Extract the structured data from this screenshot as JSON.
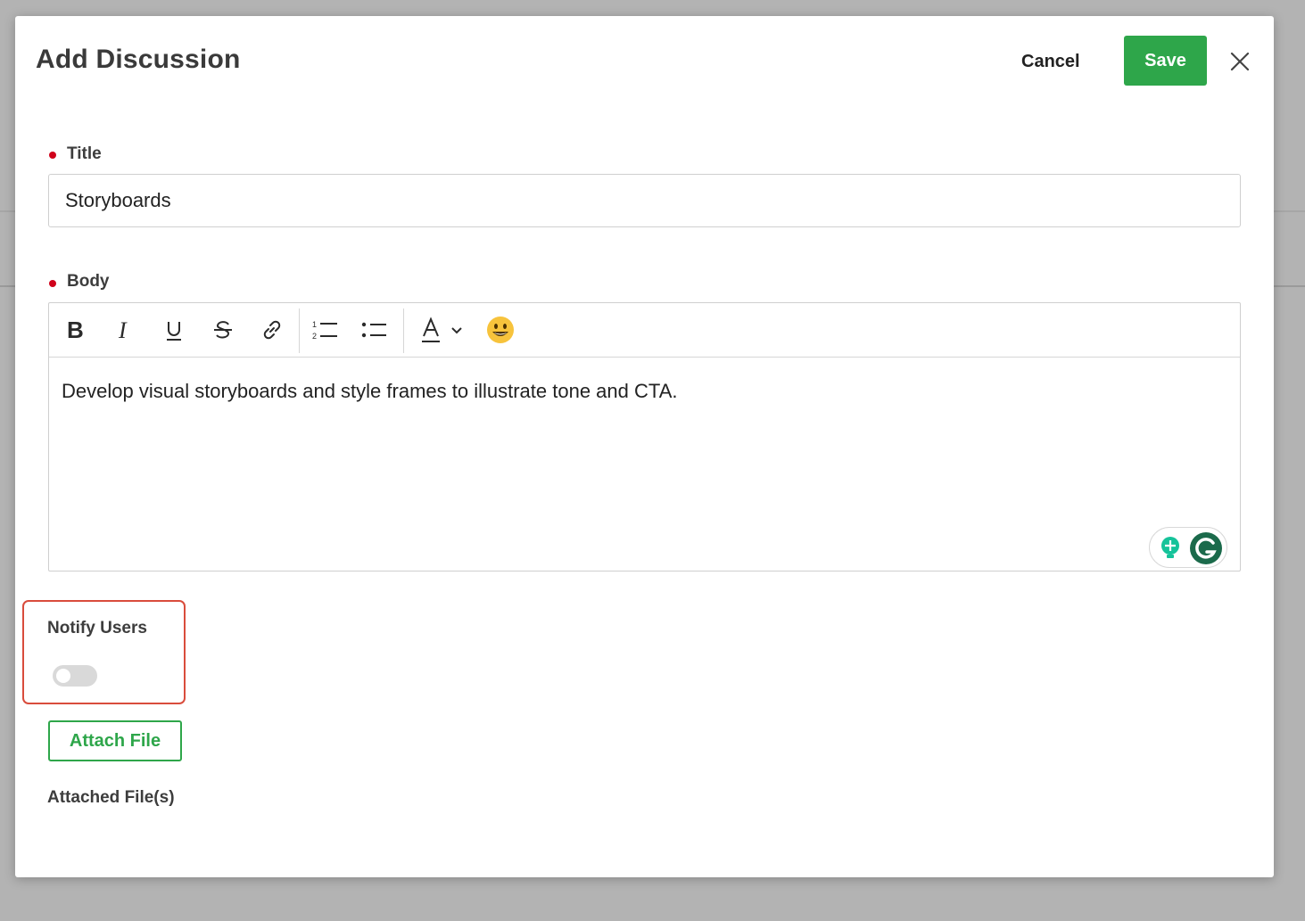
{
  "modal": {
    "title": "Add Discussion",
    "cancel_label": "Cancel",
    "save_label": "Save",
    "close_icon": "close-icon"
  },
  "form": {
    "title_label": "Title",
    "title_value": "Storyboards",
    "body_label": "Body",
    "body_text": "Develop visual storyboards and style frames to illustrate tone and CTA.",
    "toolbar": [
      "bold-icon",
      "italic-icon",
      "underline-icon",
      "strikethrough-icon",
      "link-icon",
      "ordered-list-icon",
      "bullet-list-icon",
      "text-color-icon",
      "chevron-down-icon",
      "emoji-icon"
    ],
    "notify_label": "Notify Users",
    "notify_on": false,
    "attach_label": "Attach File",
    "attached_label": "Attached File(s)"
  },
  "colors": {
    "primary_green": "#2ea64a",
    "required_red": "#d0021b",
    "highlight_border": "#d94c3c"
  }
}
